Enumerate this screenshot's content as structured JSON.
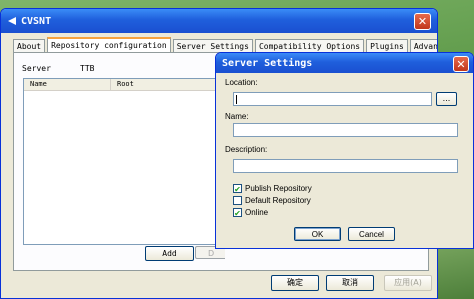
{
  "main_window": {
    "title": "CVSNT",
    "tabs": [
      {
        "label": "About"
      },
      {
        "label": "Repository configuration"
      },
      {
        "label": "Server Settings"
      },
      {
        "label": "Compatibility Options"
      },
      {
        "label": "Plugins"
      },
      {
        "label": "Advanced"
      }
    ],
    "server_label": "Server",
    "server_value": "TTB",
    "list_columns": [
      "Name",
      "Root"
    ],
    "add_button": "Add",
    "partial_button": "D",
    "ok_button": "确定",
    "cancel_button": "取消",
    "apply_button": "应用(A)"
  },
  "dialog": {
    "title": "Server Settings",
    "location_label": "Location:",
    "location_value": "",
    "browse_button": "...",
    "name_label": "Name:",
    "name_value": "",
    "description_label": "Description:",
    "description_value": "",
    "checkboxes": [
      {
        "label": "Publish Repository",
        "checked": true
      },
      {
        "label": "Default Repository",
        "checked": false
      },
      {
        "label": "Online",
        "checked": true
      }
    ],
    "ok_button": "OK",
    "cancel_button": "Cancel"
  },
  "colors": {
    "titlebar": "#1f5fdc",
    "window_bg": "#ece9d8",
    "close_button": "#c1361b",
    "desktop": "#6fa85a"
  }
}
